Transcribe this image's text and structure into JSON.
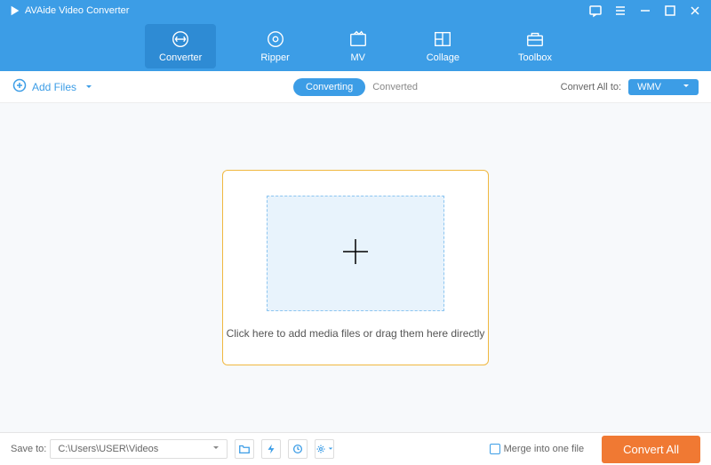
{
  "app": {
    "title": "AVAide Video Converter"
  },
  "nav": {
    "converter": "Converter",
    "ripper": "Ripper",
    "mv": "MV",
    "collage": "Collage",
    "toolbox": "Toolbox"
  },
  "toolbar": {
    "add_files": "Add Files",
    "converting": "Converting",
    "converted": "Converted",
    "convert_all_label": "Convert All to:",
    "format": "WMV"
  },
  "dropzone": {
    "text": "Click here to add media files or drag them here directly"
  },
  "footer": {
    "save_to_label": "Save to:",
    "save_path": "C:\\Users\\USER\\Videos",
    "merge_label": "Merge into one file",
    "convert_btn": "Convert All"
  }
}
